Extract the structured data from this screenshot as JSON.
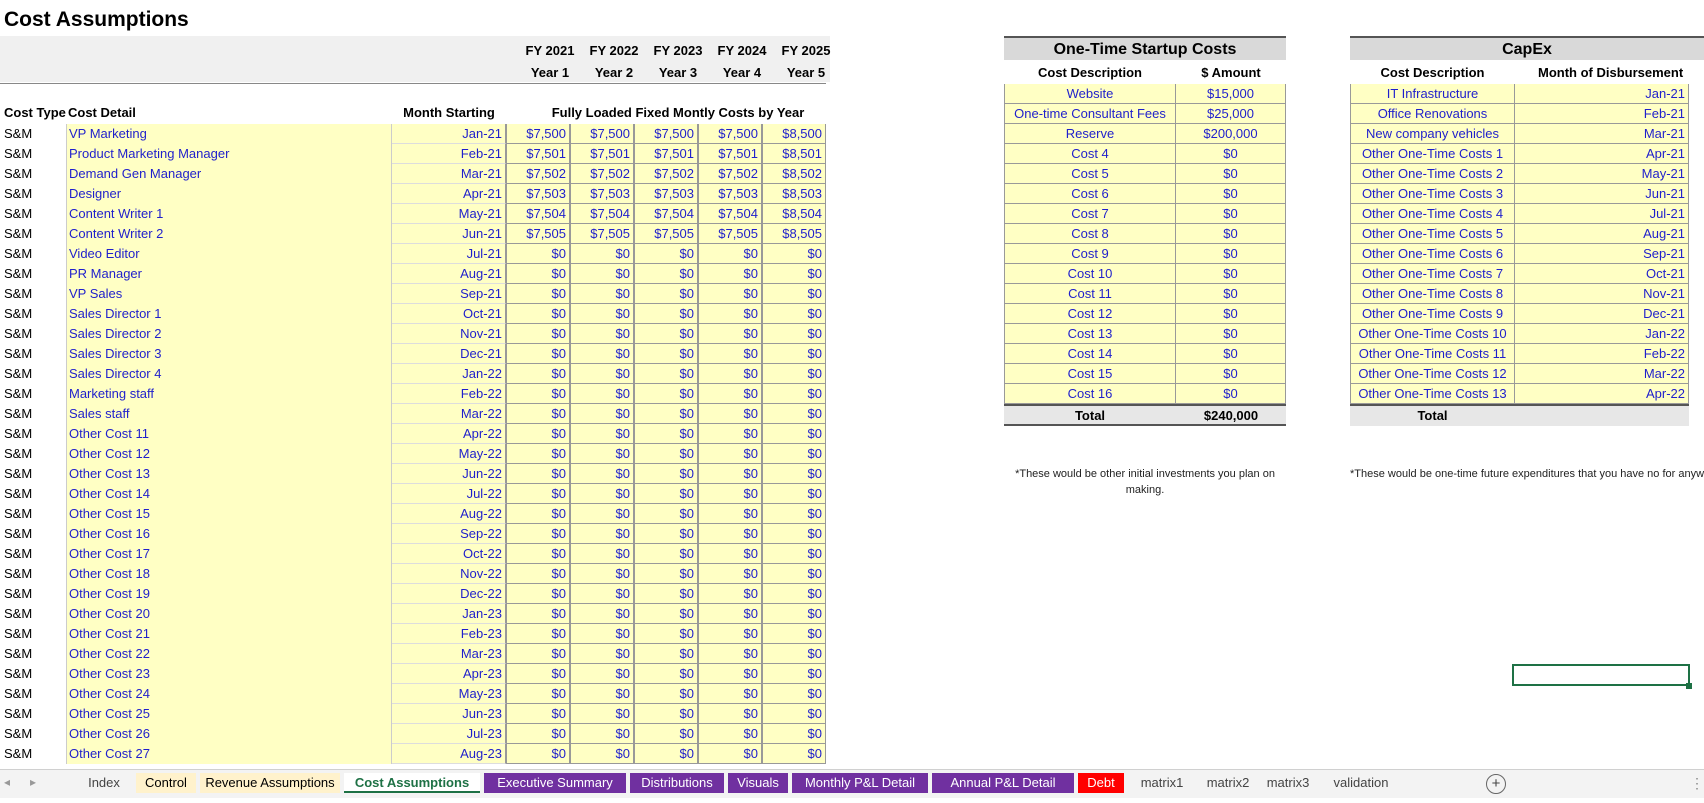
{
  "sheet_title": "Cost Assumptions",
  "fy_headers": [
    "FY 2021",
    "FY 2022",
    "FY 2023",
    "FY 2024",
    "FY 2025"
  ],
  "year_headers": [
    "Year 1",
    "Year 2",
    "Year 3",
    "Year 4",
    "Year 5"
  ],
  "left_table": {
    "col_cost_type": "Cost Type",
    "col_cost_detail": "Cost Detail",
    "col_month_starting": "Month Starting",
    "col_fixed_costs": "Fully Loaded Fixed Montly Costs by Year",
    "rows": [
      {
        "type": "S&M",
        "detail": "VP Marketing",
        "month": "Jan-21",
        "costs": [
          "$7,500",
          "$7,500",
          "$7,500",
          "$7,500",
          "$8,500"
        ]
      },
      {
        "type": "S&M",
        "detail": "Product Marketing Manager",
        "month": "Feb-21",
        "costs": [
          "$7,501",
          "$7,501",
          "$7,501",
          "$7,501",
          "$8,501"
        ]
      },
      {
        "type": "S&M",
        "detail": "Demand Gen Manager",
        "month": "Mar-21",
        "costs": [
          "$7,502",
          "$7,502",
          "$7,502",
          "$7,502",
          "$8,502"
        ]
      },
      {
        "type": "S&M",
        "detail": "Designer",
        "month": "Apr-21",
        "costs": [
          "$7,503",
          "$7,503",
          "$7,503",
          "$7,503",
          "$8,503"
        ]
      },
      {
        "type": "S&M",
        "detail": "Content Writer 1",
        "month": "May-21",
        "costs": [
          "$7,504",
          "$7,504",
          "$7,504",
          "$7,504",
          "$8,504"
        ]
      },
      {
        "type": "S&M",
        "detail": "Content Writer 2",
        "month": "Jun-21",
        "costs": [
          "$7,505",
          "$7,505",
          "$7,505",
          "$7,505",
          "$8,505"
        ]
      },
      {
        "type": "S&M",
        "detail": "Video Editor",
        "month": "Jul-21",
        "costs": [
          "$0",
          "$0",
          "$0",
          "$0",
          "$0"
        ]
      },
      {
        "type": "S&M",
        "detail": "PR Manager",
        "month": "Aug-21",
        "costs": [
          "$0",
          "$0",
          "$0",
          "$0",
          "$0"
        ]
      },
      {
        "type": "S&M",
        "detail": "VP Sales",
        "month": "Sep-21",
        "costs": [
          "$0",
          "$0",
          "$0",
          "$0",
          "$0"
        ]
      },
      {
        "type": "S&M",
        "detail": "Sales Director 1",
        "month": "Oct-21",
        "costs": [
          "$0",
          "$0",
          "$0",
          "$0",
          "$0"
        ]
      },
      {
        "type": "S&M",
        "detail": "Sales Director 2",
        "month": "Nov-21",
        "costs": [
          "$0",
          "$0",
          "$0",
          "$0",
          "$0"
        ]
      },
      {
        "type": "S&M",
        "detail": "Sales Director 3",
        "month": "Dec-21",
        "costs": [
          "$0",
          "$0",
          "$0",
          "$0",
          "$0"
        ]
      },
      {
        "type": "S&M",
        "detail": "Sales Director 4",
        "month": "Jan-22",
        "costs": [
          "$0",
          "$0",
          "$0",
          "$0",
          "$0"
        ]
      },
      {
        "type": "S&M",
        "detail": "Marketing staff",
        "month": "Feb-22",
        "costs": [
          "$0",
          "$0",
          "$0",
          "$0",
          "$0"
        ]
      },
      {
        "type": "S&M",
        "detail": "Sales staff",
        "month": "Mar-22",
        "costs": [
          "$0",
          "$0",
          "$0",
          "$0",
          "$0"
        ]
      },
      {
        "type": "S&M",
        "detail": "Other Cost 11",
        "month": "Apr-22",
        "costs": [
          "$0",
          "$0",
          "$0",
          "$0",
          "$0"
        ]
      },
      {
        "type": "S&M",
        "detail": "Other Cost 12",
        "month": "May-22",
        "costs": [
          "$0",
          "$0",
          "$0",
          "$0",
          "$0"
        ]
      },
      {
        "type": "S&M",
        "detail": "Other Cost 13",
        "month": "Jun-22",
        "costs": [
          "$0",
          "$0",
          "$0",
          "$0",
          "$0"
        ]
      },
      {
        "type": "S&M",
        "detail": "Other Cost 14",
        "month": "Jul-22",
        "costs": [
          "$0",
          "$0",
          "$0",
          "$0",
          "$0"
        ]
      },
      {
        "type": "S&M",
        "detail": "Other Cost 15",
        "month": "Aug-22",
        "costs": [
          "$0",
          "$0",
          "$0",
          "$0",
          "$0"
        ]
      },
      {
        "type": "S&M",
        "detail": "Other Cost 16",
        "month": "Sep-22",
        "costs": [
          "$0",
          "$0",
          "$0",
          "$0",
          "$0"
        ]
      },
      {
        "type": "S&M",
        "detail": "Other Cost 17",
        "month": "Oct-22",
        "costs": [
          "$0",
          "$0",
          "$0",
          "$0",
          "$0"
        ]
      },
      {
        "type": "S&M",
        "detail": "Other Cost 18",
        "month": "Nov-22",
        "costs": [
          "$0",
          "$0",
          "$0",
          "$0",
          "$0"
        ]
      },
      {
        "type": "S&M",
        "detail": "Other Cost 19",
        "month": "Dec-22",
        "costs": [
          "$0",
          "$0",
          "$0",
          "$0",
          "$0"
        ]
      },
      {
        "type": "S&M",
        "detail": "Other Cost 20",
        "month": "Jan-23",
        "costs": [
          "$0",
          "$0",
          "$0",
          "$0",
          "$0"
        ]
      },
      {
        "type": "S&M",
        "detail": "Other Cost 21",
        "month": "Feb-23",
        "costs": [
          "$0",
          "$0",
          "$0",
          "$0",
          "$0"
        ]
      },
      {
        "type": "S&M",
        "detail": "Other Cost 22",
        "month": "Mar-23",
        "costs": [
          "$0",
          "$0",
          "$0",
          "$0",
          "$0"
        ]
      },
      {
        "type": "S&M",
        "detail": "Other Cost 23",
        "month": "Apr-23",
        "costs": [
          "$0",
          "$0",
          "$0",
          "$0",
          "$0"
        ]
      },
      {
        "type": "S&M",
        "detail": "Other Cost 24",
        "month": "May-23",
        "costs": [
          "$0",
          "$0",
          "$0",
          "$0",
          "$0"
        ]
      },
      {
        "type": "S&M",
        "detail": "Other Cost 25",
        "month": "Jun-23",
        "costs": [
          "$0",
          "$0",
          "$0",
          "$0",
          "$0"
        ]
      },
      {
        "type": "S&M",
        "detail": "Other Cost 26",
        "month": "Jul-23",
        "costs": [
          "$0",
          "$0",
          "$0",
          "$0",
          "$0"
        ]
      },
      {
        "type": "S&M",
        "detail": "Other Cost 27",
        "month": "Aug-23",
        "costs": [
          "$0",
          "$0",
          "$0",
          "$0",
          "$0"
        ]
      }
    ]
  },
  "startup": {
    "title": "One-Time Startup Costs",
    "col_desc": "Cost Description",
    "col_amount": "$ Amount",
    "rows": [
      {
        "desc": "Website",
        "amount": "$15,000"
      },
      {
        "desc": "One-time Consultant Fees",
        "amount": "$25,000"
      },
      {
        "desc": "Reserve",
        "amount": "$200,000"
      },
      {
        "desc": "Cost 4",
        "amount": "$0"
      },
      {
        "desc": "Cost 5",
        "amount": "$0"
      },
      {
        "desc": "Cost 6",
        "amount": "$0"
      },
      {
        "desc": "Cost 7",
        "amount": "$0"
      },
      {
        "desc": "Cost 8",
        "amount": "$0"
      },
      {
        "desc": "Cost 9",
        "amount": "$0"
      },
      {
        "desc": "Cost 10",
        "amount": "$0"
      },
      {
        "desc": "Cost 11",
        "amount": "$0"
      },
      {
        "desc": "Cost 12",
        "amount": "$0"
      },
      {
        "desc": "Cost 13",
        "amount": "$0"
      },
      {
        "desc": "Cost 14",
        "amount": "$0"
      },
      {
        "desc": "Cost 15",
        "amount": "$0"
      },
      {
        "desc": "Cost 16",
        "amount": "$0"
      }
    ],
    "total_label": "Total",
    "total_value": "$240,000",
    "note": "*These would be other initial investments you plan on making."
  },
  "capex": {
    "title": "CapEx",
    "col_desc": "Cost Description",
    "col_month": "Month of Disbursement",
    "rows": [
      {
        "desc": "IT Infrastructure",
        "month": "Jan-21"
      },
      {
        "desc": "Office Renovations",
        "month": "Feb-21"
      },
      {
        "desc": "New company vehicles",
        "month": "Mar-21"
      },
      {
        "desc": "Other One-Time Costs 1",
        "month": "Apr-21"
      },
      {
        "desc": "Other One-Time Costs 2",
        "month": "May-21"
      },
      {
        "desc": "Other One-Time Costs 3",
        "month": "Jun-21"
      },
      {
        "desc": "Other One-Time Costs 4",
        "month": "Jul-21"
      },
      {
        "desc": "Other One-Time Costs 5",
        "month": "Aug-21"
      },
      {
        "desc": "Other One-Time Costs 6",
        "month": "Sep-21"
      },
      {
        "desc": "Other One-Time Costs 7",
        "month": "Oct-21"
      },
      {
        "desc": "Other One-Time Costs 8",
        "month": "Nov-21"
      },
      {
        "desc": "Other One-Time Costs 9",
        "month": "Dec-21"
      },
      {
        "desc": "Other One-Time Costs 10",
        "month": "Jan-22"
      },
      {
        "desc": "Other One-Time Costs 11",
        "month": "Feb-22"
      },
      {
        "desc": "Other One-Time Costs 12",
        "month": "Mar-22"
      },
      {
        "desc": "Other One-Time Costs 13",
        "month": "Apr-22"
      }
    ],
    "total_label": "Total",
    "note": "*These would be one-time future expenditures that you have no for anywhere else."
  },
  "tabs": [
    {
      "label": "Index",
      "style": "plain"
    },
    {
      "label": "Control",
      "style": "yellowtab"
    },
    {
      "label": "Revenue Assumptions",
      "style": "yellowtab"
    },
    {
      "label": "Cost Assumptions",
      "style": "active"
    },
    {
      "label": "Executive Summary",
      "style": "purple"
    },
    {
      "label": "Distributions",
      "style": "purple"
    },
    {
      "label": "Visuals",
      "style": "purple"
    },
    {
      "label": "Monthly P&L Detail",
      "style": "purple"
    },
    {
      "label": "Annual P&L Detail",
      "style": "purple"
    },
    {
      "label": "Debt",
      "style": "red"
    },
    {
      "label": "matrix1",
      "style": "plain"
    },
    {
      "label": "matrix2",
      "style": "plain"
    },
    {
      "label": "matrix3",
      "style": "plain"
    },
    {
      "label": "validation",
      "style": "plain"
    }
  ],
  "add_sheet_glyph": "+",
  "more_glyph": "⋮",
  "nav_prev": "◂",
  "nav_next": "▸"
}
